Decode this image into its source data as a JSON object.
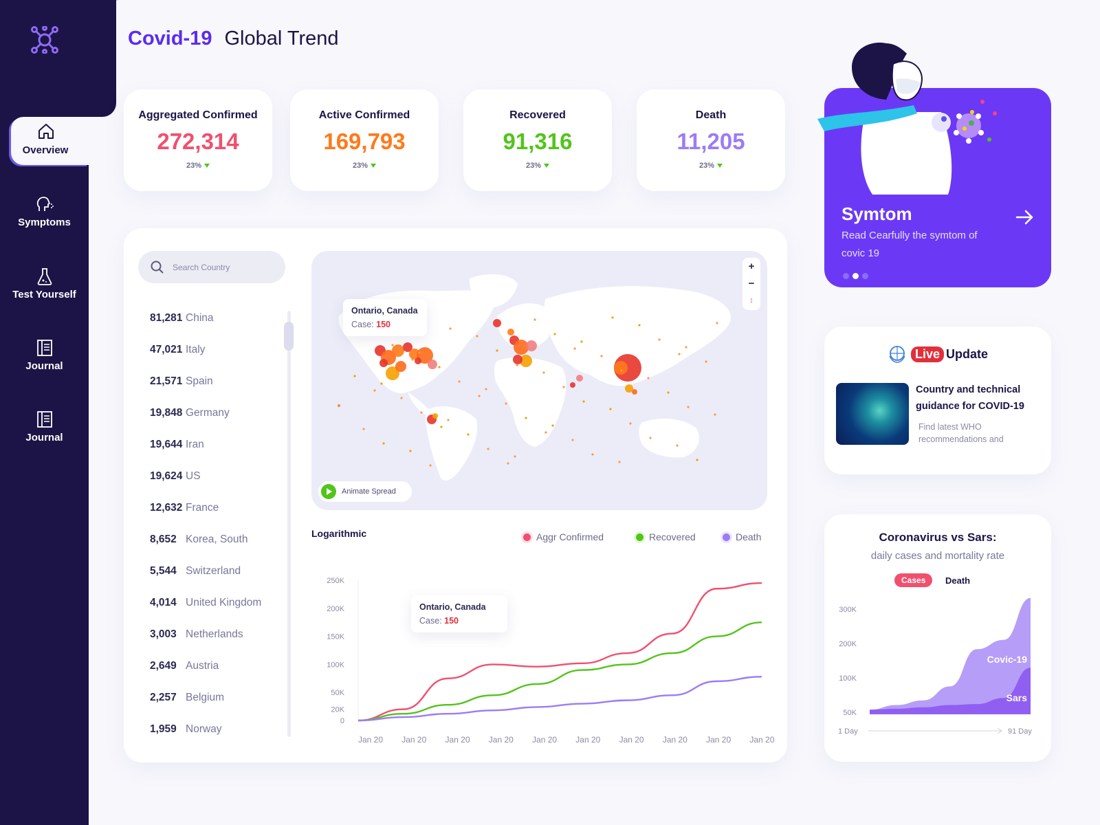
{
  "header": {
    "brand": "Covid-19",
    "title": "Global Trend"
  },
  "sidebar": {
    "items": [
      {
        "label": "Overview",
        "icon": "home-icon",
        "active": true
      },
      {
        "label": "Symptoms",
        "icon": "head-cough-icon"
      },
      {
        "label": "Test Yourself",
        "icon": "flask-icon"
      },
      {
        "label": "Journal",
        "icon": "journal-icon"
      },
      {
        "label": "Journal",
        "icon": "journal-icon"
      }
    ]
  },
  "stats": [
    {
      "label": "Aggregated Confirmed",
      "value": "272,314",
      "pct": "23%",
      "color": "#f0506e"
    },
    {
      "label": "Active Confirmed",
      "value": "169,793",
      "pct": "23%",
      "color": "#ff7a1a"
    },
    {
      "label": "Recovered",
      "value": "91,316",
      "pct": "23%",
      "color": "#52c41a"
    },
    {
      "label": "Death",
      "value": "11,205",
      "pct": "23%",
      "color": "#9b7cf5"
    }
  ],
  "search": {
    "placeholder": "Search Country"
  },
  "countries": [
    {
      "count": "81,281",
      "name": "China"
    },
    {
      "count": "47,021",
      "name": "Italy"
    },
    {
      "count": "21,571",
      "name": "Spain"
    },
    {
      "count": "19,848",
      "name": "Germany"
    },
    {
      "count": "19,644",
      "name": "Iran"
    },
    {
      "count": "19,624",
      "name": "US"
    },
    {
      "count": "12,632",
      "name": "France"
    },
    {
      "count": "8,652",
      "name": "Korea, South"
    },
    {
      "count": "5,544",
      "name": "Switzerland"
    },
    {
      "count": "4,014",
      "name": "United Kingdom"
    },
    {
      "count": "3,003",
      "name": "Netherlands"
    },
    {
      "count": "2,649",
      "name": "Austria"
    },
    {
      "count": "2,257",
      "name": "Belgium"
    },
    {
      "count": "1,959",
      "name": "Norway"
    }
  ],
  "map": {
    "tooltip": {
      "location": "Ontario, Canada",
      "case_label": "Case:",
      "case_value": "150"
    },
    "zoom_in": "+",
    "zoom_out": "−",
    "animate_label": "Animate Spread"
  },
  "trend": {
    "scale_label": "Logarithmic",
    "legend": [
      {
        "name": "Aggr Confirmed",
        "color": "#f0506e"
      },
      {
        "name": "Recovered",
        "color": "#52c41a"
      },
      {
        "name": "Death",
        "color": "#9b7cf5"
      }
    ],
    "tooltip": {
      "location": "Ontario, Canada",
      "case_label": "Case:",
      "case_value": "150"
    }
  },
  "symtom": {
    "title": "Symtom",
    "text": "Read Cearfully the symtom of covic 19",
    "dots": 3,
    "active_dot": 1
  },
  "live": {
    "badge": "Live",
    "title": "Update",
    "news_title": "Country and technical guidance for COVID-19",
    "news_sub": "Find latest WHO recommendations and"
  },
  "sars": {
    "title": "Coronavirus vs Sars:",
    "subtitle": "daily cases and mortality rate",
    "tab_active": "Cases",
    "tab_other": "Death",
    "x_start": "1 Day",
    "x_end": "91 Day"
  },
  "chart_data": [
    {
      "type": "line",
      "xlabel": "",
      "ylabel": "",
      "categories": [
        "Jan 20",
        "Jan 20",
        "Jan 20",
        "Jan 20",
        "Jan 20",
        "Jan 20",
        "Jan 20",
        "Jan 20",
        "Jan 20",
        "Jan 20"
      ],
      "y_ticks": [
        "0",
        "20K",
        "50K",
        "100K",
        "150K",
        "200K",
        "250K"
      ],
      "series": [
        {
          "name": "Aggr Confirmed",
          "values": [
            0,
            20,
            75,
            100,
            96,
            102,
            120,
            155,
            235,
            245
          ]
        },
        {
          "name": "Recovered",
          "values": [
            0,
            12,
            28,
            45,
            65,
            90,
            100,
            120,
            150,
            175
          ]
        },
        {
          "name": "Death",
          "values": [
            0,
            6,
            12,
            18,
            24,
            30,
            36,
            45,
            70,
            78
          ]
        }
      ]
    },
    {
      "type": "area",
      "y_ticks": [
        "50K",
        "100K",
        "200K",
        "300K"
      ],
      "x_labels": [
        "1 Day",
        "91 Day"
      ],
      "series": [
        {
          "name": "Covic-19",
          "values": [
            50,
            60,
            70,
            100,
            180,
            200,
            290
          ]
        },
        {
          "name": "Sars",
          "values": [
            50,
            52,
            55,
            60,
            62,
            75,
            140
          ]
        }
      ]
    }
  ]
}
